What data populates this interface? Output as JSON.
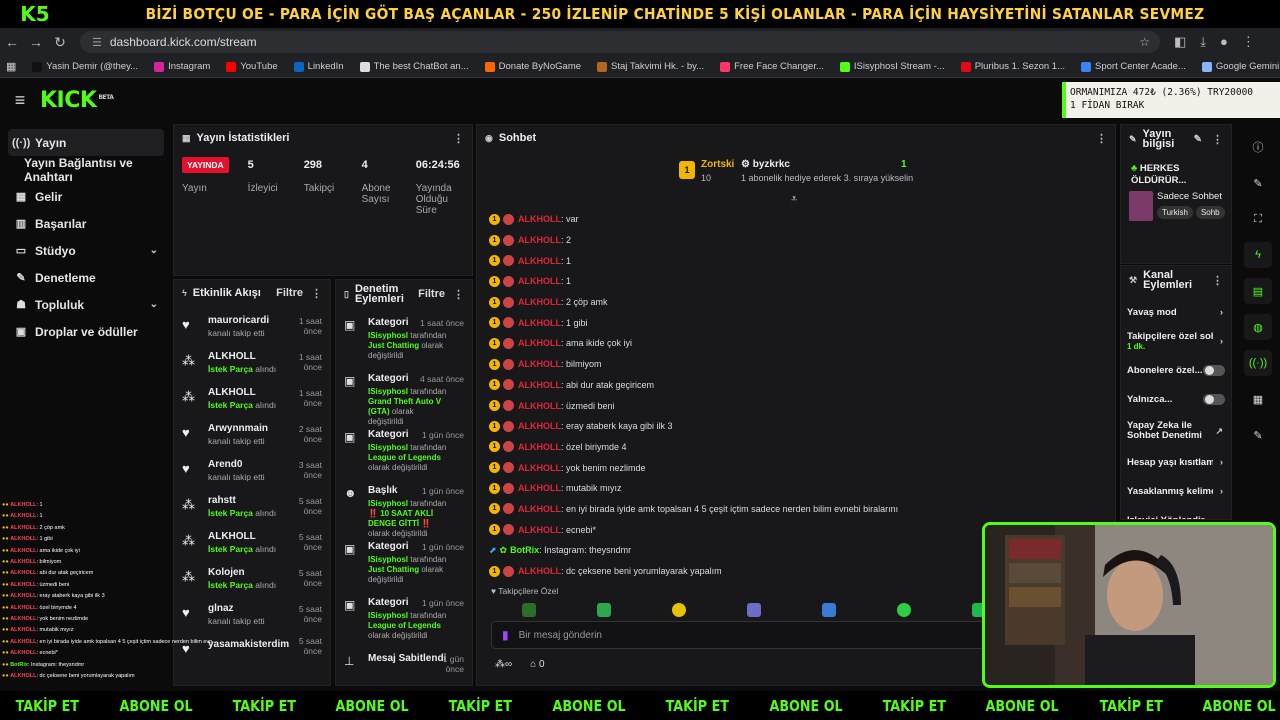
{
  "banner": {
    "logo": "K5",
    "text": "BİZİ BOTÇU OE - PARA İÇİN GÖT BAŞ AÇANLAR - 250 İZLENİP CHATİNDE 5 KİŞİ OLANLAR - PARA İÇİN HAYSİYETİNİ SATANLAR SEVMEZ"
  },
  "browser": {
    "url": "dashboard.kick.com/stream",
    "bookmarks": [
      {
        "label": "Yasin Demir (@they...",
        "color": "#111111"
      },
      {
        "label": "Instagram",
        "color": "#d6249f"
      },
      {
        "label": "YouTube",
        "color": "#ff0000"
      },
      {
        "label": "LinkedIn",
        "color": "#0a66c2"
      },
      {
        "label": "The best ChatBot an...",
        "color": "#dddddd"
      },
      {
        "label": "Donate ByNoGame",
        "color": "#ff6600"
      },
      {
        "label": "Staj Takvimi Hk. - by...",
        "color": "#b5651d"
      },
      {
        "label": "Free Face Changer...",
        "color": "#ff3366"
      },
      {
        "label": "ISisyphosI Stream -...",
        "color": "#53fc18"
      },
      {
        "label": "Pluribus 1. Sezon 1...",
        "color": "#e50914"
      },
      {
        "label": "Sport Center Acade...",
        "color": "#3b82f6"
      },
      {
        "label": "Google Gemini",
        "color": "#8ab4f8"
      },
      {
        "label": "Kicklet.app - Kick C...",
        "color": "#53fc18"
      }
    ]
  },
  "ticker": {
    "line1": "ORMANIMIZA   472₺ (2.36%)   TRY20000",
    "line2": "1 FİDAN BIRAK"
  },
  "kick": {
    "logo": "KICK",
    "beta": "BETA"
  },
  "sidebar": {
    "items": [
      {
        "label": "Yayın"
      },
      {
        "label": "Yayın Bağlantısı ve Anahtarı"
      },
      {
        "label": "Gelir"
      },
      {
        "label": "Başarılar"
      },
      {
        "label": "Stüdyo"
      },
      {
        "label": "Denetleme"
      },
      {
        "label": "Topluluk"
      },
      {
        "label": "Droplar ve ödüller"
      }
    ]
  },
  "stats": {
    "title": "Yayın İstatistikleri",
    "live_badge": "YAYINDA",
    "live_label": "Yayın",
    "items": [
      {
        "value": "5",
        "label": "İzleyici"
      },
      {
        "value": "298",
        "label": "Takipçi"
      },
      {
        "value": "4",
        "label": "Abone Sayısı"
      },
      {
        "value": "06:24:56",
        "label": "Yayında Olduğu Süre"
      }
    ]
  },
  "activity": {
    "title": "Etkinlik Akışı",
    "filter": "Filtre",
    "items": [
      {
        "name": "mauroricardi",
        "time": "1 saat önce",
        "sub": "kanalı takip etti",
        "hl": "",
        "type": "heart"
      },
      {
        "name": "ALKHOLL",
        "time": "1 saat önce",
        "sub": "alındı",
        "hl": "İstek Parça",
        "type": "gift"
      },
      {
        "name": "ALKHOLL",
        "time": "1 saat önce",
        "sub": "alındı",
        "hl": "İstek Parça",
        "type": "gift"
      },
      {
        "name": "Arwynnmain",
        "time": "2 saat önce",
        "sub": "kanalı takip etti",
        "hl": "",
        "type": "heart"
      },
      {
        "name": "Arend0",
        "time": "3 saat önce",
        "sub": "kanalı takip etti",
        "hl": "",
        "type": "heart"
      },
      {
        "name": "rahstt",
        "time": "5 saat önce",
        "sub": "alındı",
        "hl": "İstek Parça",
        "type": "gift"
      },
      {
        "name": "ALKHOLL",
        "time": "5 saat önce",
        "sub": "alındı",
        "hl": "İstek Parça",
        "type": "gift"
      },
      {
        "name": "Kolojen",
        "time": "5 saat önce",
        "sub": "alındı",
        "hl": "İstek Parça",
        "type": "gift"
      },
      {
        "name": "glnaz",
        "time": "5 saat önce",
        "sub": "kanalı takip etti",
        "hl": "",
        "type": "heart"
      },
      {
        "name": "yasamakisterdim",
        "time": "5 saat önce",
        "sub": "",
        "hl": "",
        "type": "heart"
      }
    ]
  },
  "modlog": {
    "title": "Denetim Eylemleri",
    "filter": "Filtre",
    "items": [
      {
        "title": "Kategori",
        "time": "1 saat önce",
        "actor": "ISisyphosI",
        "mid": " tarafından ",
        "value": "Just Chatting",
        "end": " olarak değiştirildi"
      },
      {
        "title": "Kategori",
        "time": "4 saat önce",
        "actor": "ISisyphosI",
        "mid": " tarafından ",
        "value": "Grand Theft Auto V (GTA)",
        "end": " olarak değiştirildi"
      },
      {
        "title": "Kategori",
        "time": "1 gün önce",
        "actor": "ISisyphosI",
        "mid": " tarafından ",
        "value": "League of Legends",
        "end": " olarak değiştirildi"
      },
      {
        "title": "Başlık",
        "time": "1 gün önce",
        "actor": "ISisyphosI",
        "mid": " tarafından ‼️ ",
        "value": "10 SAAT AKLİ DENGE GİTTİ ‼️",
        "end": " olarak değiştirildi"
      },
      {
        "title": "Kategori",
        "time": "1 gün önce",
        "actor": "ISisyphosI",
        "mid": " tarafından ",
        "value": "Just Chatting",
        "end": " olarak değiştirildi"
      },
      {
        "title": "Kategori",
        "time": "1 gün önce",
        "actor": "ISisyphosI",
        "mid": " tarafından ",
        "value": "League of Legends",
        "end": " olarak değiştirildi"
      },
      {
        "title": "Mesaj Sabitlendi",
        "time": "1 gün önce",
        "actor": "",
        "mid": "",
        "value": "",
        "end": ""
      }
    ]
  },
  "chat": {
    "title": "Sohbet",
    "gift": {
      "user1": "Zortski",
      "user1_count": "10",
      "user2": "byzkrkc",
      "text": "1 abonelik hediye ederek 3. sıraya yükselin",
      "count": "1"
    },
    "messages": [
      {
        "user": "ALKHOLL",
        "text": ": var"
      },
      {
        "user": "ALKHOLL",
        "text": ": 2"
      },
      {
        "user": "ALKHOLL",
        "text": ": 1"
      },
      {
        "user": "ALKHOLL",
        "text": ": 1"
      },
      {
        "user": "ALKHOLL",
        "text": ": 2 çöp amk"
      },
      {
        "user": "ALKHOLL",
        "text": ": 1 gibi"
      },
      {
        "user": "ALKHOLL",
        "text": ": ama ikide çok iyi"
      },
      {
        "user": "ALKHOLL",
        "text": ": bilmiyom"
      },
      {
        "user": "ALKHOLL",
        "text": ": abi dur atak geçiricem"
      },
      {
        "user": "ALKHOLL",
        "text": ": üzmedi beni"
      },
      {
        "user": "ALKHOLL",
        "text": ": eray ataberk kaya gibi ilk 3"
      },
      {
        "user": "ALKHOLL",
        "text": ": özel biriymde 4"
      },
      {
        "user": "ALKHOLL",
        "text": ": yok benim nezlimde"
      },
      {
        "user": "ALKHOLL",
        "text": ": mutabik mıyız"
      },
      {
        "user": "ALKHOLL",
        "text": ": en iyi birada iyide amk topalsan 4 5 çeşit içtim sadece nerden bilim evnebi biralarını"
      },
      {
        "user": "ALKHOLL",
        "text": ": ecnebi*"
      },
      {
        "user": "BotRix",
        "text": ": Instagram: theysndmr"
      },
      {
        "user": "ALKHOLL",
        "text": ": dc çeksene beni yorumlayarak yapalım"
      }
    ],
    "followers_only": "Takipçilere Özel",
    "placeholder": "Bir mesaj gönderin",
    "footer_count": "0"
  },
  "streaminfo": {
    "title": "Yayın bilgisi",
    "stream_title": "HERKES ÖLDÜRÜR...",
    "category": "Sadece Sohbet",
    "tags": [
      "Turkish",
      "Sohb"
    ]
  },
  "channel_actions": {
    "title": "Kanal Eylemleri",
    "items": [
      {
        "label": "Yavaş mod",
        "kind": "chev",
        "sub": ""
      },
      {
        "label": "Takipçilere özel sohb",
        "kind": "chev",
        "sub": "1 dk."
      },
      {
        "label": "Abonelere özel...",
        "kind": "toggle",
        "sub": ""
      },
      {
        "label": "Yalnızca...",
        "kind": "toggle",
        "sub": ""
      },
      {
        "label": "Yapay Zeka ile Sohbet Denetimi",
        "kind": "ext",
        "sub": ""
      },
      {
        "label": "Hesap yaşı kısıtlam",
        "kind": "chev",
        "sub": ""
      },
      {
        "label": "Yasaklanmış kelime",
        "kind": "chev",
        "sub": ""
      },
      {
        "label": "İzleyici Yönlendir",
        "kind": "none",
        "sub": ""
      }
    ]
  },
  "overlay_chat": [
    {
      "user": "ALKHOLL",
      "text": ": 1"
    },
    {
      "user": "ALKHOLL",
      "text": ": 1"
    },
    {
      "user": "ALKHOLL",
      "text": ": 2 çöp amk"
    },
    {
      "user": "ALKHOLL",
      "text": ": 1 gibi"
    },
    {
      "user": "ALKHOLL",
      "text": ": ama ikide çok iyi"
    },
    {
      "user": "ALKHOLL",
      "text": ": bilmiyom"
    },
    {
      "user": "ALKHOLL",
      "text": ": abi dur atak geçiricem"
    },
    {
      "user": "ALKHOLL",
      "text": ": üzmedi beni"
    },
    {
      "user": "ALKHOLL",
      "text": ": eray ataberk kaya gibi ilk 3"
    },
    {
      "user": "ALKHOLL",
      "text": ": özel biriymde 4"
    },
    {
      "user": "ALKHOLL",
      "text": ": yok benim nezlimde"
    },
    {
      "user": "ALKHOLL",
      "text": ": mutabik mıyız"
    },
    {
      "user": "ALKHOLL",
      "text": ": en iyi birada iyide amk topalsan 4 5 çeşit içtim sadece nerden bilim evnebi biralarını"
    },
    {
      "user": "ALKHOLL",
      "text": ": ecnebi*"
    },
    {
      "user": "BotRix",
      "text": ": Instagram: theysndmr"
    },
    {
      "user": "ALKHOLL",
      "text": ": dc çeksene beni yorumlayarak yapalım"
    }
  ],
  "marquee": {
    "follow": "TAKİP ET",
    "subscribe": "ABONE OL"
  },
  "colors": {
    "kick_green": "#53fc18",
    "live_red": "#e3112b",
    "username_red": "#e0253b",
    "banner_yellow": "#ffd23a"
  }
}
